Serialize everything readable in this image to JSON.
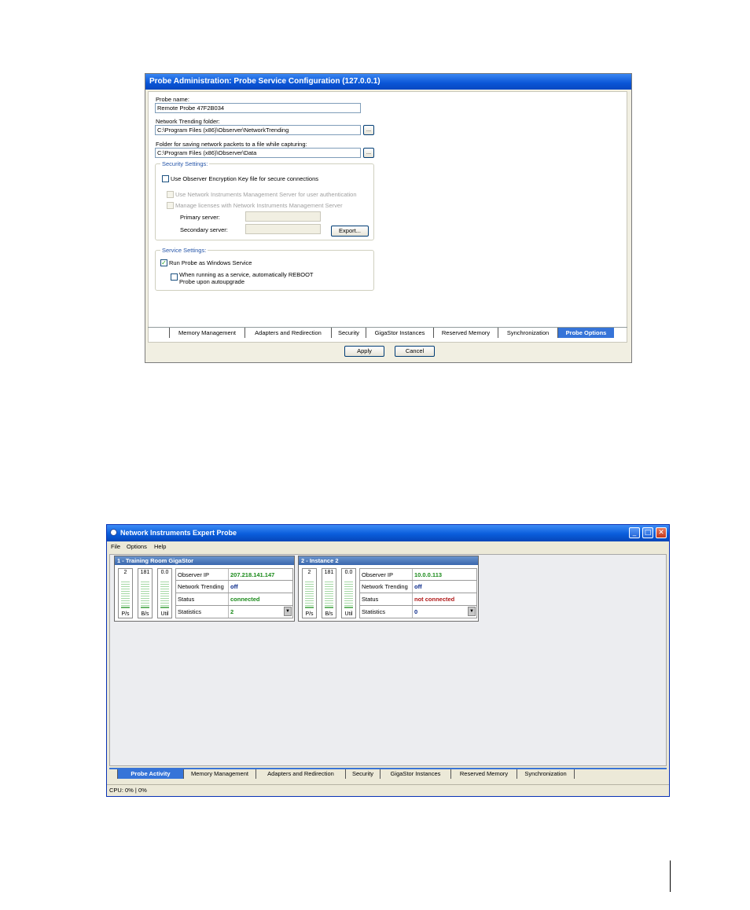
{
  "probe_config": {
    "title": "Probe Administration:  Probe Service Configuration (127.0.0.1)",
    "probe_name_label": "Probe name:",
    "probe_name_value": "Remote Probe 47F2B034",
    "nt_folder_label": "Network Trending folder:",
    "nt_folder_value": "C:\\Program Files (x86)\\Observer\\NetworkTrending",
    "browse_label": "...",
    "save_folder_label": "Folder for saving network packets to a file while capturing:",
    "save_folder_value": "C:\\Program Files (x86)\\Observer\\Data",
    "security": {
      "group_label": "Security Settings:",
      "encryption_label": "Use Observer Encryption Key file for secure connections",
      "nims_auth_label": "Use Network Instruments Management Server for user authentication",
      "nims_license_label": "Manage licenses with Network Instruments Management Server",
      "primary_label": "Primary server:",
      "secondary_label": "Secondary server:",
      "export_label": "Export..."
    },
    "service": {
      "group_label": "Service Settings:",
      "run_as_service_label": "Run Probe as Windows  Service",
      "reboot_label_1": "When running as a service, automatically REBOOT",
      "reboot_label_2": "Probe upon autoupgrade"
    },
    "tabs": [
      "Memory Management",
      "Adapters and Redirection",
      "Security",
      "GigaStor Instances",
      "Reserved Memory",
      "Synchronization",
      "Probe Options"
    ],
    "active_tab": "Probe Options",
    "apply_label": "Apply",
    "cancel_label": "Cancel"
  },
  "expert_probe": {
    "title": "Network Instruments Expert Probe",
    "menu": [
      "File",
      "Options",
      "Help"
    ],
    "instances": [
      {
        "header": "1 - Training Room GigaStor",
        "meters": [
          {
            "value": "2",
            "unit": "P/s"
          },
          {
            "value": "181",
            "unit": "B/s"
          },
          {
            "value": "0.0",
            "unit": "Util"
          }
        ],
        "rows": [
          {
            "key": "Observer IP",
            "value": "207.218.141.147",
            "color": "#1a8a1a"
          },
          {
            "key": "Network Trending",
            "value": "off",
            "color": "#0a2a8a"
          },
          {
            "key": "Status",
            "value": "connected",
            "color": "#1a8a1a"
          },
          {
            "key": "Statistics",
            "value": "2",
            "color": "#1a8a1a"
          }
        ]
      },
      {
        "header": "2 - Instance 2",
        "meters": [
          {
            "value": "2",
            "unit": "P/s"
          },
          {
            "value": "181",
            "unit": "B/s"
          },
          {
            "value": "0.0",
            "unit": "Util"
          }
        ],
        "rows": [
          {
            "key": "Observer IP",
            "value": "10.0.0.113",
            "color": "#1a8a1a"
          },
          {
            "key": "Network Trending",
            "value": "off",
            "color": "#0a2a8a"
          },
          {
            "key": "Status",
            "value": "not connected",
            "color": "#b01818"
          },
          {
            "key": "Statistics",
            "value": "0",
            "color": "#0a2a8a"
          }
        ]
      }
    ],
    "tabs": [
      "Probe Activity",
      "Memory Management",
      "Adapters and Redirection",
      "Security",
      "GigaStor Instances",
      "Reserved Memory",
      "Synchronization"
    ],
    "active_tab": "Probe Activity",
    "status_text": "CPU:  0% | 0%"
  }
}
